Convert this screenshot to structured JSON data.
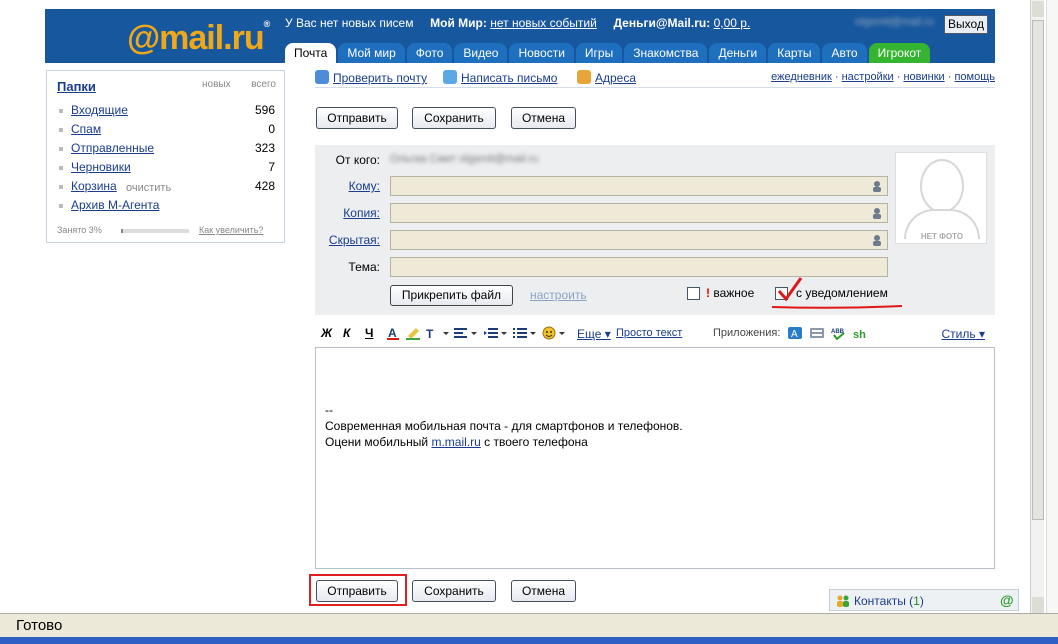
{
  "header": {
    "logo": "@mail.ru",
    "logo_reg": "®",
    "no_new_mail": "У Вас нет новых писем",
    "my_world_label": "Мой Мир:",
    "my_world_link": "нет новых событий",
    "money_label": "Деньги@Mail.ru:",
    "money_link": "0,00 р.",
    "user_email": "olgsmit@mail.ru",
    "logout": "Выход",
    "tabs": [
      "Почта",
      "Мой мир",
      "Фото",
      "Видео",
      "Новости",
      "Игры",
      "Знакомства",
      "Деньги",
      "Карты",
      "Авто",
      "Игрокот"
    ]
  },
  "sidebar": {
    "title": "Папки",
    "col_new": "новых",
    "col_total": "всего",
    "folders": [
      {
        "name": "Входящие",
        "count": "596"
      },
      {
        "name": "Спам",
        "count": "0"
      },
      {
        "name": "Отправленные",
        "count": "323"
      },
      {
        "name": "Черновики",
        "count": "7"
      },
      {
        "name": "Корзина",
        "clear": "очистить",
        "count": "428"
      },
      {
        "name": "Архив М-Агента",
        "count": ""
      }
    ],
    "quota": "Занято 3%",
    "quota_fraction": 0.03,
    "quota_link": "Как увеличить?"
  },
  "actions": {
    "check_mail": "Проверить почту",
    "write": "Написать письмо",
    "addresses": "Адреса",
    "right_links": [
      "ежедневник",
      "настройки",
      "новинки",
      "помощь"
    ]
  },
  "buttons": {
    "send": "Отправить",
    "save": "Сохранить",
    "cancel": "Отмена"
  },
  "form": {
    "from_label": "От кого:",
    "from_value": "Ольгаа Смит olgsmit@mail.ru",
    "to_label": "Кому:",
    "cc_label": "Копия:",
    "bcc_label": "Скрытая:",
    "subject_label": "Тема:",
    "attach": "Прикрепить файл",
    "configure": "настроить",
    "important": "важное",
    "important_mark": "!",
    "notify": "с уведомлением",
    "photo_caption": "НЕТ ФОТО"
  },
  "toolbar": {
    "bold": "Ж",
    "italic": "К",
    "underline": "Ч",
    "more": "Еще",
    "plain_text": "Просто текст",
    "apps": "Приложения:",
    "style": "Стиль"
  },
  "editor": {
    "sig_dash": "--",
    "line1": "Современная мобильная почта - для смартфонов и телефонов.",
    "line2_pre": "Оцени мобильный ",
    "line2_link": "m.mail.ru",
    "line2_post": " с твоего телефона"
  },
  "contacts": {
    "label": "Контакты (",
    "count": "1",
    "close": ")",
    "at": "@"
  },
  "status": {
    "text": "Готово"
  }
}
